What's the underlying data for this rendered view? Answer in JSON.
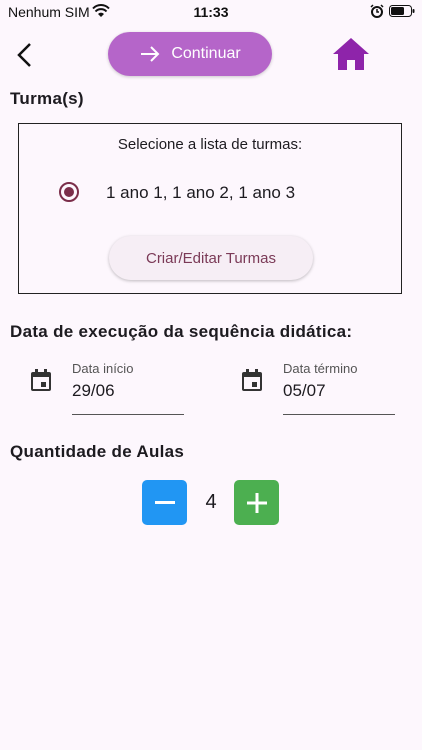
{
  "status_bar": {
    "carrier": "Nenhum SIM",
    "time": "11:33"
  },
  "toolbar": {
    "continue_label": "Continuar",
    "home_color": "#8e24aa",
    "continue_color": "#b565c9"
  },
  "turmas": {
    "title": "Turma(s)",
    "prompt": "Selecione a lista de turmas:",
    "selected_list": "1 ano 1, 1 ano 2, 1 ano 3",
    "edit_button": "Criar/Editar Turmas"
  },
  "execution": {
    "title": "Data de execução da sequência didática:",
    "start": {
      "label": "Data início",
      "value": "29/06"
    },
    "end": {
      "label": "Data término",
      "value": "05/07"
    }
  },
  "lessons": {
    "title": "Quantidade de Aulas",
    "count": "4",
    "minus_color": "#2196f3",
    "plus_color": "#4caf50"
  }
}
